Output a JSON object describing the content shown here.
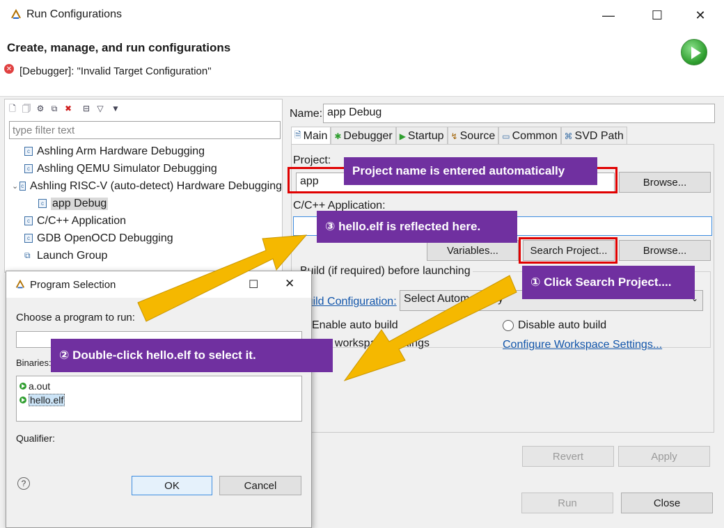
{
  "window": {
    "title": "Run Configurations",
    "minimize": "—",
    "maximize": "☐",
    "close": "✕"
  },
  "header": {
    "title": "Create, manage, and run configurations",
    "error_message": "[Debugger]: \"Invalid Target Configuration\""
  },
  "left_panel": {
    "filter_placeholder": "type filter text",
    "items": [
      {
        "label": "Ashling Arm Hardware Debugging"
      },
      {
        "label": "Ashling QEMU Simulator Debugging"
      },
      {
        "label": "Ashling RISC-V (auto-detect) Hardware Debugging",
        "expanded": true
      },
      {
        "label": "app Debug",
        "selected": true
      },
      {
        "label": "C/C++ Application"
      },
      {
        "label": "GDB OpenOCD Debugging"
      },
      {
        "label": "Launch Group"
      }
    ]
  },
  "config": {
    "name_label": "Name:",
    "name_value": "app Debug",
    "tabs": [
      {
        "label": "Main",
        "active": true
      },
      {
        "label": "Debugger"
      },
      {
        "label": "Startup"
      },
      {
        "label": "Source"
      },
      {
        "label": "Common"
      },
      {
        "label": "SVD Path"
      }
    ],
    "project_label": "Project:",
    "project_value": "app",
    "browse_label": "Browse...",
    "app_label": "C/C++ Application:",
    "app_value": "",
    "variables_label": "Variables...",
    "search_project_label": "Search Project...",
    "build_group_label": "Build (if required) before launching",
    "build_config_link": "Build Configuration:",
    "build_config_value": "Select Automatically",
    "enable_auto_build": "Enable auto build",
    "disable_auto_build": "Disable auto build",
    "use_workspace": "Use workspace settings",
    "configure_workspace_link": "Configure Workspace Settings..."
  },
  "buttons": {
    "revert": "Revert",
    "apply": "Apply",
    "run": "Run",
    "close": "Close"
  },
  "dialog": {
    "title": "Program Selection",
    "choose_label": "Choose a program to run:",
    "filter_value": "",
    "binaries_label": "Binaries:",
    "binaries": [
      "a.out",
      "hello.elf"
    ],
    "qualifier_label": "Qualifier:",
    "ok": "OK",
    "cancel": "Cancel",
    "help": "?"
  },
  "annotations": {
    "project_callout": "Project name is entered automatically",
    "step3": "③ hello.elf is reflected here.",
    "step1": "① Click Search Project....",
    "step2": "② Double-click hello.elf to select it.",
    "arrow_color": "#f5b800",
    "callout_color": "#7030a0",
    "highlight_color": "#e00000"
  }
}
